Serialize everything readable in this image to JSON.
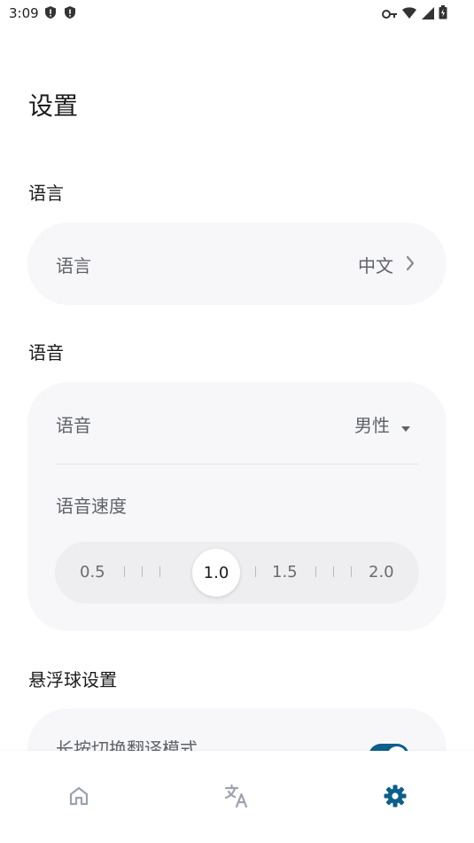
{
  "status_bar": {
    "time": "3:09"
  },
  "page": {
    "title": "设置"
  },
  "sections": {
    "language": {
      "title": "语言",
      "row_label": "语言",
      "row_value": "中文"
    },
    "voice": {
      "title": "语音",
      "voice_label": "语音",
      "voice_value": "男性",
      "speed_label": "语音速度",
      "slider": {
        "ticks": [
          "0.5",
          "1.0",
          "1.5",
          "2.0"
        ],
        "selected": "1.0"
      }
    },
    "floating_ball": {
      "title": "悬浮球设置",
      "long_press_label": "长按切换翻译模式",
      "toggle_on": true
    }
  },
  "bottom_nav": {
    "items": [
      {
        "icon": "home-icon",
        "active": false
      },
      {
        "icon": "translate-icon",
        "active": false
      },
      {
        "icon": "settings-icon",
        "active": true
      }
    ]
  },
  "colors": {
    "accent": "#0b5f8a",
    "inactive_icon": "#9aa3ad",
    "card_bg": "#f7f7f9"
  }
}
